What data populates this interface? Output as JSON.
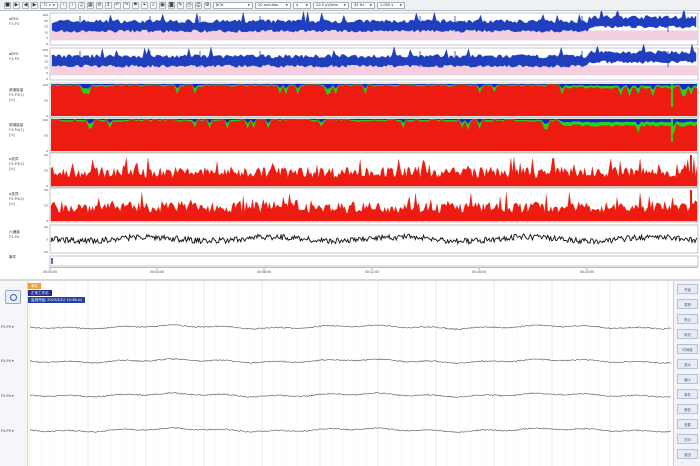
{
  "toolbar": {
    "zoom": "72 s",
    "montage": "8CH",
    "duration": "20 minutes",
    "page": "4",
    "sensitivity": "10.0 μV/mm",
    "filter": "35 Hz",
    "timeconst": "1.000 s"
  },
  "trend_rows": [
    {
      "label": "aEEG",
      "unit": "F3-P3"
    },
    {
      "label": "aEEG",
      "unit": "F4-P4"
    },
    {
      "label": "频谱能量",
      "unit": "F3-P3(1)",
      "unit2": "[%]"
    },
    {
      "label": "频谱能量",
      "unit": "F4-P4(1)",
      "unit2": "[%]"
    },
    {
      "label": "α变异",
      "unit": "F3-P3(2)",
      "unit2": "[%]"
    },
    {
      "label": "α变异",
      "unit": "F4-P4(2)",
      "unit2": "[%]"
    },
    {
      "label": "六通道",
      "unit": "F3-P4"
    },
    {
      "label": "事件"
    }
  ],
  "yticks": {
    "aeeg": [
      "100",
      "50",
      "25",
      "10",
      "5",
      "0"
    ],
    "spec": [
      "100",
      "50",
      "0"
    ],
    "alpha": [
      "50",
      "25",
      "0"
    ],
    "six": [
      "50",
      "0",
      "-50"
    ]
  },
  "time_labels": [
    "00:00:00",
    "00:04:00",
    "00:08:00",
    "00:12:00",
    "00:16:00",
    "00:20:00"
  ],
  "eeg": {
    "tag1": "事件",
    "tag2": "正常工作站",
    "tag3": "监测开始: 2023/4/12 10:36:41",
    "channels": [
      "F3-P3 ▾",
      "F4-P4 ▾",
      "F3-P4 ▾",
      "F4-P3 ▾"
    ],
    "side_buttons": [
      "开始",
      "暂停",
      "停止",
      "标记",
      "时间轴",
      "放大",
      "缩小",
      "事件",
      "报告",
      "设置",
      "打印",
      "退出"
    ]
  },
  "colors": {
    "aeeg_band": "#1f3fbf",
    "aeeg_bg": "#f3cfe0",
    "spectrum_red": "#ee1b10",
    "spectrum_green": "#29d11b",
    "spectrum_blue": "#1426c8",
    "alpha_red": "#ee1b10",
    "six_black": "#111111"
  }
}
